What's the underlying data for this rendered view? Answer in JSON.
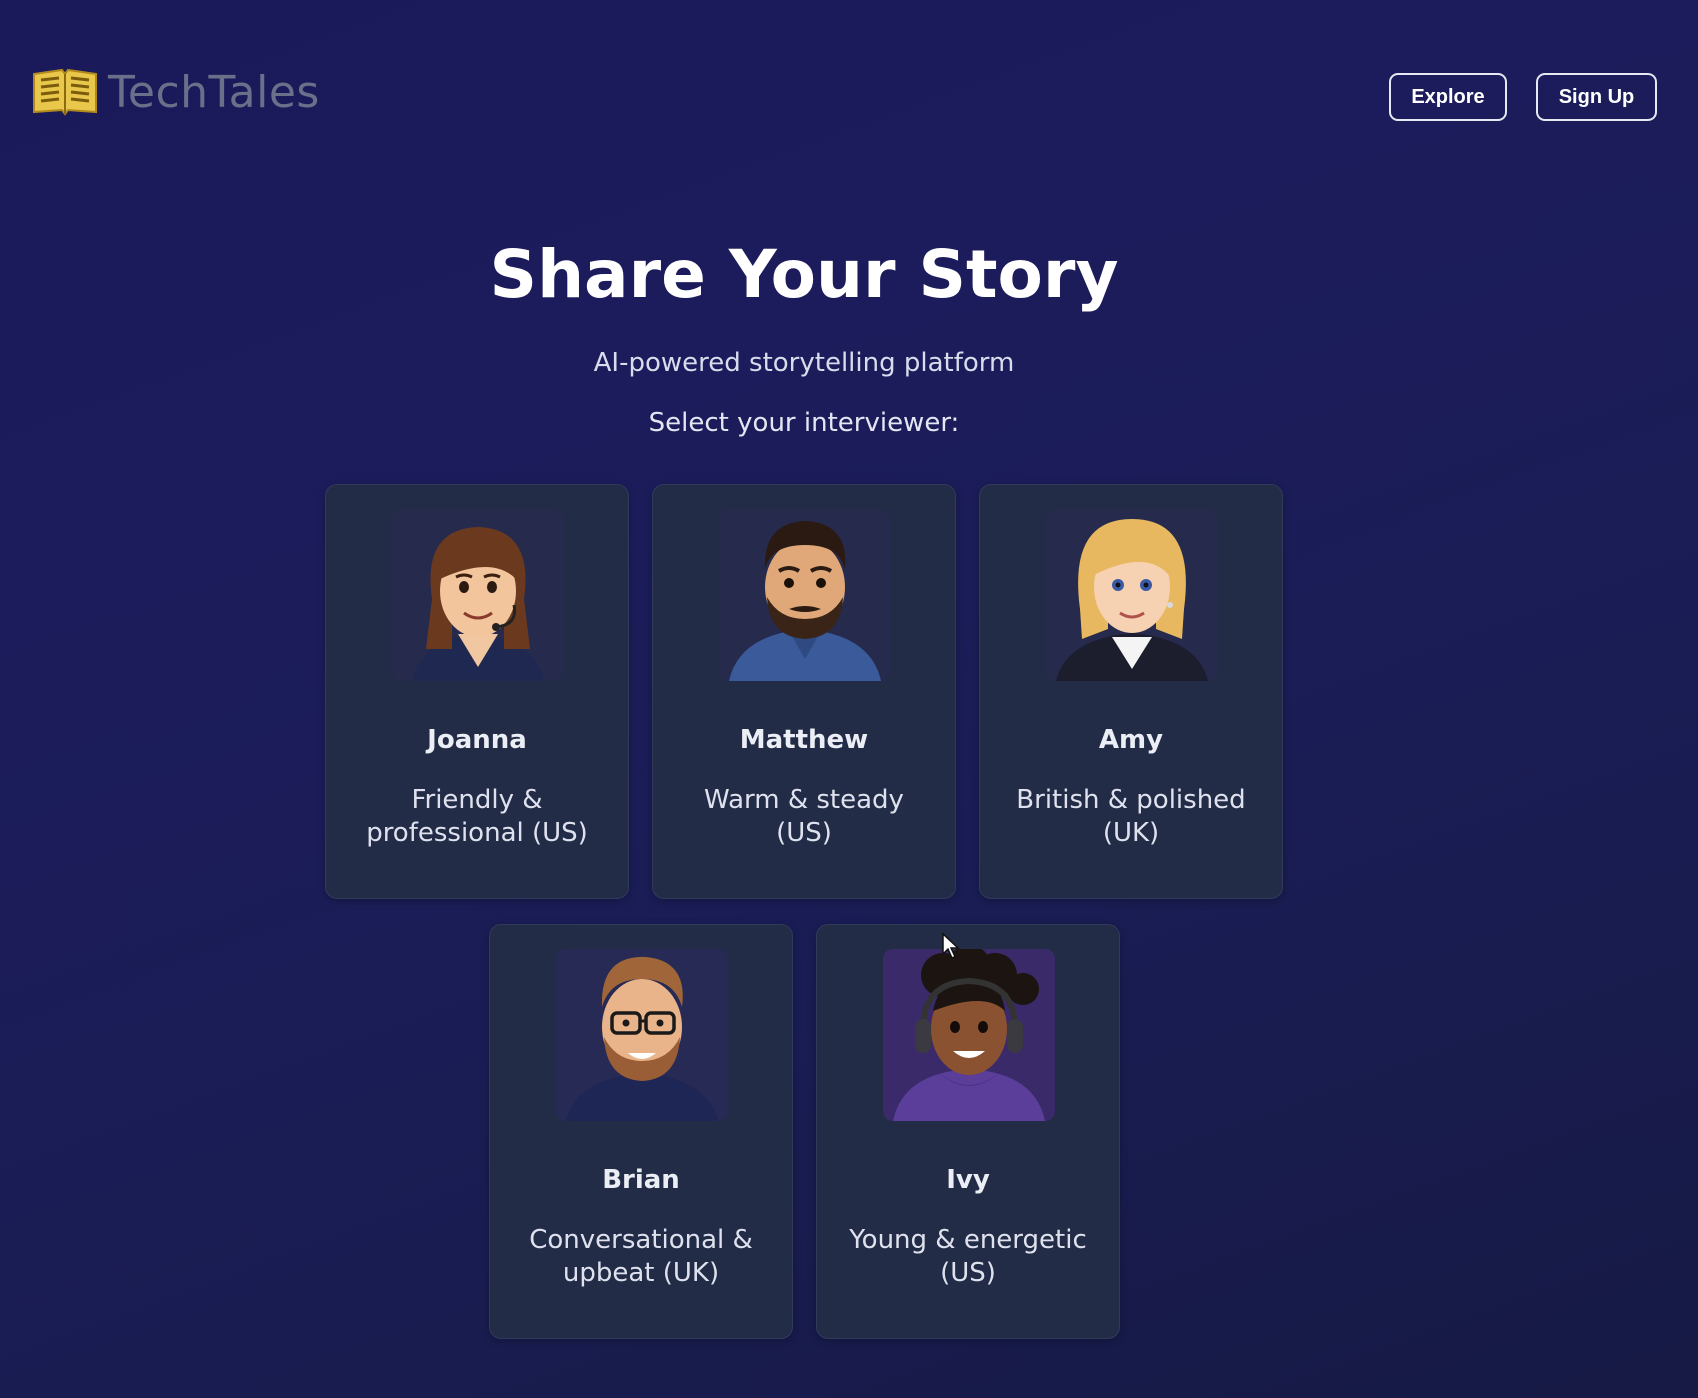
{
  "brand": {
    "name": "TechTales",
    "icon": "open-book-icon",
    "colors": {
      "book": "#e9c74a",
      "text": "#6a6f8a"
    }
  },
  "nav": {
    "explore_label": "Explore",
    "signup_label": "Sign Up"
  },
  "hero": {
    "title": "Share Your Story",
    "subtitle": "AI-powered storytelling platform",
    "select_label": "Select your interviewer:"
  },
  "interviewers": [
    {
      "name": "Joanna",
      "description": "Friendly & professional (US)",
      "avatar": "woman-brown-hair-headset-avatar"
    },
    {
      "name": "Matthew",
      "description": "Warm & steady (US)",
      "avatar": "man-beard-blue-shirt-avatar"
    },
    {
      "name": "Amy",
      "description": "British & polished (UK)",
      "avatar": "woman-blonde-blazer-avatar"
    },
    {
      "name": "Brian",
      "description": "Conversational & upbeat (UK)",
      "avatar": "man-glasses-beard-avatar"
    },
    {
      "name": "Ivy",
      "description": "Young & energetic (US)",
      "avatar": "woman-curly-hair-headphones-avatar"
    }
  ],
  "theme": {
    "background": "#1b1c5a",
    "card_background": "#222c47",
    "card_border": "#303b5c",
    "button_border": "#e6e8f2"
  }
}
